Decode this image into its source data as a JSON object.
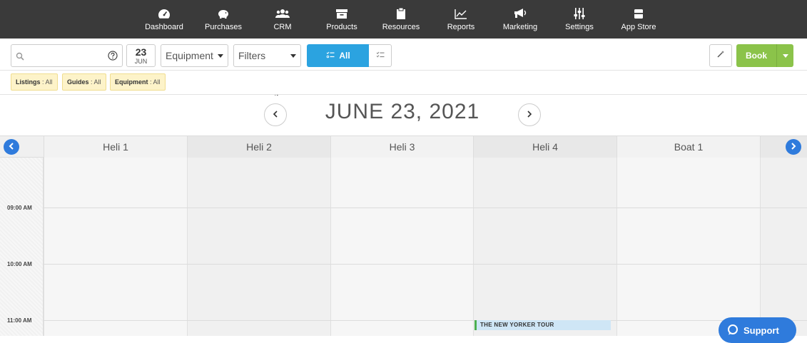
{
  "nav": {
    "items": [
      {
        "label": "Dashboard",
        "icon": "gauge-icon"
      },
      {
        "label": "Purchases",
        "icon": "piggy-bank-icon"
      },
      {
        "label": "CRM",
        "icon": "users-icon"
      },
      {
        "label": "Products",
        "icon": "archive-box-icon"
      },
      {
        "label": "Resources",
        "icon": "clipboard-icon"
      },
      {
        "label": "Reports",
        "icon": "line-chart-icon"
      },
      {
        "label": "Marketing",
        "icon": "megaphone-icon"
      },
      {
        "label": "Settings",
        "icon": "sliders-icon"
      },
      {
        "label": "App Store",
        "icon": "store-icon"
      }
    ]
  },
  "toolbar": {
    "search_value": "",
    "date_day": "23",
    "date_month": "JUN",
    "equipment_select": "Equipment",
    "filters_select": "Filters",
    "toggle_all_label": "All",
    "book_label": "Book"
  },
  "chips": [
    {
      "key": "Listings",
      "value": "All"
    },
    {
      "key": "Guides",
      "value": "All"
    },
    {
      "key": "Equipment",
      "value": "All"
    }
  ],
  "calendar": {
    "date_title": "JUNE 23, 2021",
    "columns": [
      "Heli 1",
      "Heli 2",
      "Heli 3",
      "Heli 4",
      "Boat 1"
    ],
    "time_labels": [
      "09:00 AM",
      "10:00 AM",
      "11:00 AM"
    ],
    "event_title": "THE NEW YORKER TOUR"
  },
  "support": {
    "label": "Support"
  },
  "colors": {
    "nav_bg": "#3a3a3a",
    "primary_blue": "#2ba3e0",
    "book_green": "#8bc34a",
    "chip_bg": "#fdf3c9",
    "scroll_blue": "#2f7bdc"
  }
}
